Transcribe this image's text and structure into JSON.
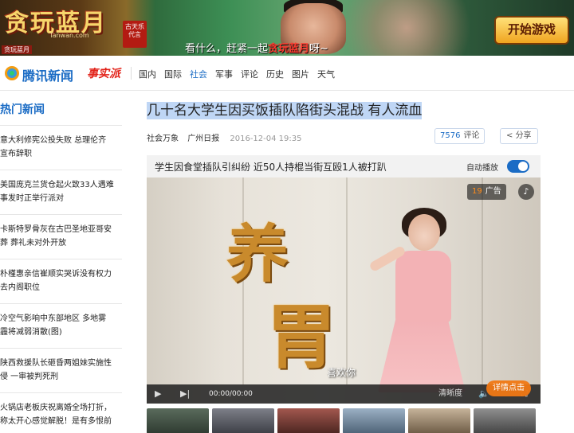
{
  "banner": {
    "game_name": "贪玩蓝月",
    "game_url": "Tanwan.com",
    "game_sub": "贪玩蓝月",
    "seal_text": "古天乐代言",
    "slogan_prefix": "看什么，赶紧一起",
    "slogan_highlight": "贪玩蓝月",
    "slogan_suffix": "呀~",
    "play_button": "开始游戏",
    "colors": {
      "button": "#f0a41f",
      "title": "#f6d56b"
    }
  },
  "nav": {
    "logo_text": "腾讯新闻",
    "logo_sub": "事实派",
    "links": [
      "国内",
      "国际",
      "社会",
      "军事",
      "评论",
      "历史",
      "图片",
      "天气"
    ],
    "active_link": "社会",
    "accent_color": "#1b6cc5"
  },
  "sidebar": {
    "title": "热门新闻",
    "items": [
      {
        "line1": "意大利修宪公投失败 总理伦齐",
        "line2": "宣布辞职"
      },
      {
        "line1": "美国庞克兰货仓起火致33人遇难",
        "line2": "事发时正举行派对"
      },
      {
        "line1": "卡斯特罗骨灰在古巴圣地亚哥安",
        "line2": "葬 葬礼未对外开放"
      },
      {
        "line1": "朴槿惠亲信崔顺实哭诉没有权力",
        "line2": "去内阁职位"
      },
      {
        "line1": "冷空气影响中东部地区 多地雾",
        "line2": "霾将减弱消散(图)"
      },
      {
        "line1": "陕西救援队长砸昏两姐妹实施性",
        "line2": "侵 一审被判死刑"
      },
      {
        "line1": "火锅店老板庆祝离婚全场打折，",
        "line2": "称太开心感觉解脱！是有多恨前"
      }
    ]
  },
  "article": {
    "title": "几十名大学生因买饭插队陷街头混战 有人流血",
    "source": "社会万象",
    "paper": "广州日报",
    "date": "2016-12-04 19:35",
    "comment_count": "7576",
    "comment_label": "评论",
    "share_label": "分享",
    "video": {
      "title": "学生因食堂插队引纠纷 近50人持棍当街互殴1人被打趴",
      "autoplay_label": "自动播放",
      "autoplay_on": true,
      "ad_countdown": "19",
      "ad_label": "广告",
      "ad_chars": [
        "养",
        "胃"
      ],
      "caption": "喜欢你",
      "time": "00:00/00:00",
      "quality": "清晰度",
      "detail_button": "详情点击"
    }
  }
}
